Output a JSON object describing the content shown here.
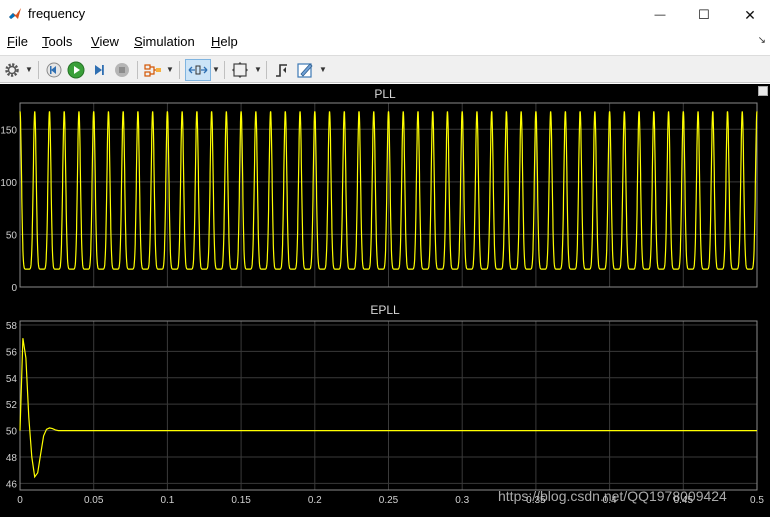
{
  "window": {
    "title": "frequency",
    "minimize_symbol": "—",
    "maximize_symbol": "☐",
    "close_symbol": "✕"
  },
  "menu": {
    "items": [
      {
        "label": "File",
        "accel": "F",
        "rest": "ile"
      },
      {
        "label": "Tools",
        "accel": "T",
        "rest": "ools"
      },
      {
        "label": "View",
        "accel": "V",
        "rest": "iew"
      },
      {
        "label": "Simulation",
        "accel": "S",
        "rest": "imulation"
      },
      {
        "label": "Help",
        "accel": "H",
        "rest": "elp"
      }
    ],
    "overflow_icon": "chevron-icon"
  },
  "toolbar": {
    "buttons": [
      "gear-icon",
      "step-back-icon",
      "run-icon",
      "step-forward-icon",
      "stop-icon",
      "highlight-icon",
      "zoom-icon",
      "fit-to-view-icon",
      "trigger-icon",
      "style-icon"
    ]
  },
  "colors": {
    "signal": "#ffff00",
    "axes_bg": "#000000",
    "grid": "#3a3a3a",
    "axis_text": "#d0d0d0"
  },
  "chart_data": [
    {
      "type": "line",
      "title": "PLL",
      "xlim": [
        0,
        0.5
      ],
      "ylim": [
        0,
        175
      ],
      "yticks": [
        "0",
        "50",
        "100",
        "150"
      ],
      "grid": true,
      "series": [
        {
          "waveform": "periodic pulse",
          "min": 17,
          "max": 167,
          "period": 0.01,
          "x_start": 0,
          "x_end": 0.5
        }
      ]
    },
    {
      "type": "line",
      "title": "EPLL",
      "xlim": [
        0,
        0.5
      ],
      "ylim": [
        45.5,
        58.3
      ],
      "yticks": [
        "46",
        "48",
        "50",
        "52",
        "54",
        "56",
        "58"
      ],
      "xticks": [
        "0",
        "0.05",
        "0.1",
        "0.15",
        "0.2",
        "0.25",
        "0.3",
        "0.35",
        "0.4",
        "0.45",
        "0.5"
      ],
      "grid": true,
      "series": [
        {
          "x": [
            0,
            0.002,
            0.004,
            0.006,
            0.008,
            0.01,
            0.012,
            0.014,
            0.016,
            0.018,
            0.02,
            0.022,
            0.024,
            0.026,
            0.03,
            0.05,
            0.5
          ],
          "y": [
            50,
            57,
            55.5,
            51,
            48,
            46.5,
            46.8,
            48.2,
            49.6,
            50.1,
            50.2,
            50.15,
            50.05,
            50,
            50,
            50,
            50
          ]
        }
      ]
    }
  ],
  "watermark": "https://blog.csdn.net/QQ1978009424"
}
